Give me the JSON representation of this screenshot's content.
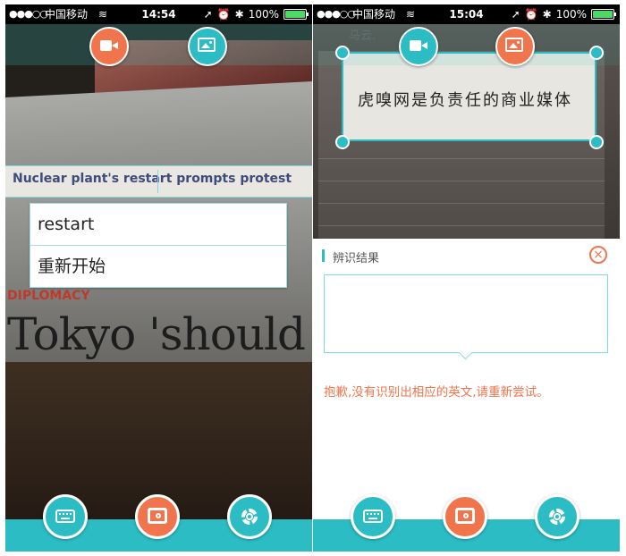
{
  "left_screen": {
    "status": {
      "signal": "●●●○○",
      "carrier": "中国移动",
      "time": "14:54",
      "battery": "100%"
    },
    "headline_text": "Nuclear plant's restart prompts protest",
    "section_label": "DIPLOMACY",
    "big_title": "Tokyo 'should r",
    "popup": {
      "word": "restart",
      "translation": "重新开始"
    }
  },
  "right_screen": {
    "status": {
      "signal": "●●●○○",
      "carrier": "中国移动",
      "time": "15:04",
      "battery": "100%"
    },
    "note_header": "马云.",
    "handwriting": "虎嗅网是负责任的商业媒体",
    "result": {
      "title": "辨识结果",
      "close_symbol": "×",
      "error_message": "抱歉,没有识别出相应的英文,请重新尝试。"
    }
  },
  "colors": {
    "accent_teal": "#2bbcc4",
    "accent_orange": "#f0754c"
  },
  "icons": [
    "video-camera-icon",
    "image-gallery-icon",
    "keyboard-icon",
    "camera-icon",
    "gear-icon",
    "close-icon",
    "wifi-icon",
    "location-icon",
    "alarm-icon",
    "bluetooth-icon",
    "battery-icon"
  ]
}
